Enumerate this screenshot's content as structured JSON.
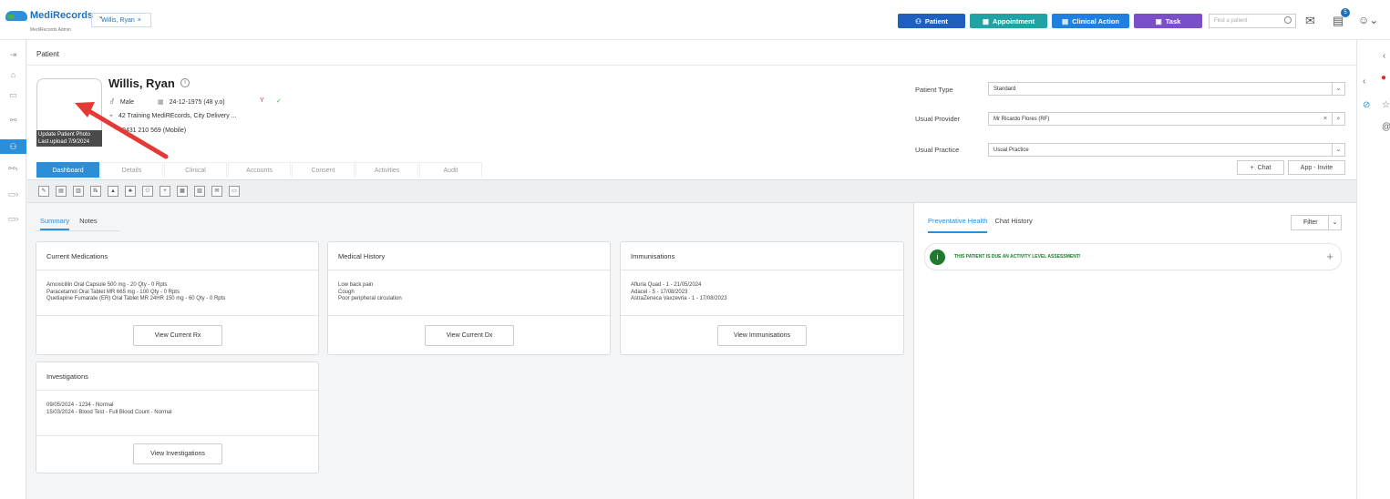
{
  "header": {
    "brand": "MediRecords",
    "brand_sub": "MediRecords Admin",
    "open_patient_tab": "Willis, Ryan",
    "buttons": {
      "patient": "Patient",
      "appointment": "Appointment",
      "clinical_action": "Clinical Action",
      "task": "Task"
    },
    "colors": {
      "patient": "#1f5fbf",
      "appointment": "#22a3a3",
      "clinical_action": "#2080e0",
      "task": "#7b4fc7"
    },
    "search_placeholder": "Find a patient",
    "notif_count": "5"
  },
  "breadcrumb": "Patient",
  "patient": {
    "name": "Willis, Ryan",
    "sex": "Male",
    "dob": "24-12-1975 (48 y.o)",
    "address": "42 Training MediREcords, City Delivery ...",
    "phone": "0431 210 569 (Mobile)",
    "photo_caption_line1": "Update Patient Photo",
    "photo_caption_line2": "Last upload 7/9/2024"
  },
  "patient_tabs": [
    "Dashboard",
    "Details",
    "Clinical",
    "Accounts",
    "Consent",
    "Activities",
    "Audit"
  ],
  "right_form": {
    "patient_type_label": "Patient Type",
    "patient_type_value": "Standard",
    "usual_provider_label": "Usual Provider",
    "usual_provider_value": "Mr Ricardo Flores (RF)",
    "usual_practice_label": "Usual Practice",
    "usual_practice_value": "Usual Practice",
    "chat_label": "Chat",
    "app_invite_label": "App - Invite"
  },
  "summary_tabs": {
    "summary": "Summary",
    "notes": "Notes"
  },
  "panels": {
    "meds": {
      "title": "Current Medications",
      "lines": [
        "Amoxicillin Oral Capsule 500 mg - 20 Qty - 0 Rpts",
        "Paracetamol Oral Tablet MR 665 mg - 100 Qty - 0 Rpts",
        "Quetiapine Fumarate (ER) Oral Tablet MR 24HR 150 mg - 60 Qty - 0 Rpts"
      ],
      "button": "View Current Rx"
    },
    "history": {
      "title": "Medical History",
      "lines": [
        "Low back pain",
        "Cough",
        "Poor peripheral circulation"
      ],
      "button": "View Current Dx"
    },
    "imm": {
      "title": "Immunisations",
      "lines": [
        "Afluria Quad - 1 - 21/05/2024",
        "Adacel - 5 - 17/08/2023",
        "AstraZeneca Vaxzevria - 1 - 17/08/2023"
      ],
      "button": "View Immunisations"
    },
    "inv": {
      "title": "Investigations",
      "lines": [
        "09/05/2024 - 1234 - Normal",
        "15/03/2024 - Blood Test - Full Blood Count - Normal"
      ],
      "button": "View Investigations"
    }
  },
  "right_panel": {
    "tab_preventative": "Preventative Health",
    "tab_chat": "Chat History",
    "filter": "Filter",
    "alert": "THIS PATIENT IS DUE AN ACTIVITY LEVEL ASSESSMENT!"
  }
}
